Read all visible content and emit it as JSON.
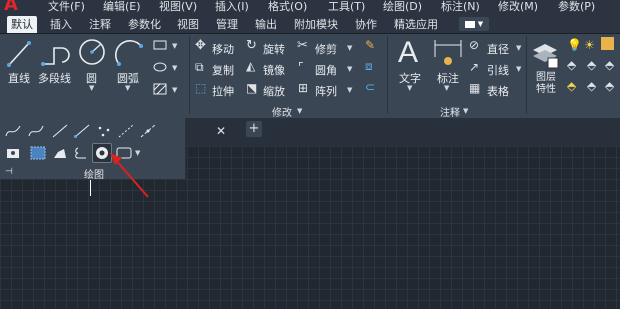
{
  "app": {
    "logo_letter": "A"
  },
  "menu": [
    {
      "label": "文件(F)"
    },
    {
      "label": "编辑(E)"
    },
    {
      "label": "视图(V)"
    },
    {
      "label": "插入(I)"
    },
    {
      "label": "格式(O)"
    },
    {
      "label": "工具(T)"
    },
    {
      "label": "绘图(D)"
    },
    {
      "label": "标注(N)"
    },
    {
      "label": "修改(M)"
    },
    {
      "label": "参数(P)"
    }
  ],
  "tabs": [
    {
      "label": "默认",
      "active": true
    },
    {
      "label": "插入"
    },
    {
      "label": "注释"
    },
    {
      "label": "参数化"
    },
    {
      "label": "视图"
    },
    {
      "label": "管理"
    },
    {
      "label": "输出"
    },
    {
      "label": "附加模块"
    },
    {
      "label": "协作"
    },
    {
      "label": "精选应用"
    }
  ],
  "draw_panel": {
    "tools": {
      "line": "直线",
      "polyline": "多段线",
      "circle": "圆",
      "arc": "圆弧"
    },
    "title": "绘图"
  },
  "modify_panel": {
    "move": "移动",
    "rotate": "旋转",
    "trim": "修剪",
    "copy": "复制",
    "mirror": "镜像",
    "fillet": "圆角",
    "stretch": "拉伸",
    "scale": "缩放",
    "array": "阵列",
    "title": "修改"
  },
  "annotation_panel": {
    "text": "文字",
    "dimension": "标注",
    "linear": "直径",
    "leader": "引线",
    "table": "表格",
    "title": "注释"
  },
  "layers_panel": {
    "layer_properties": "图层\n特性"
  },
  "colors": {
    "accent_red": "#e0262c",
    "ribbon_bg": "#3b4655",
    "canvas_bg": "#212830"
  }
}
